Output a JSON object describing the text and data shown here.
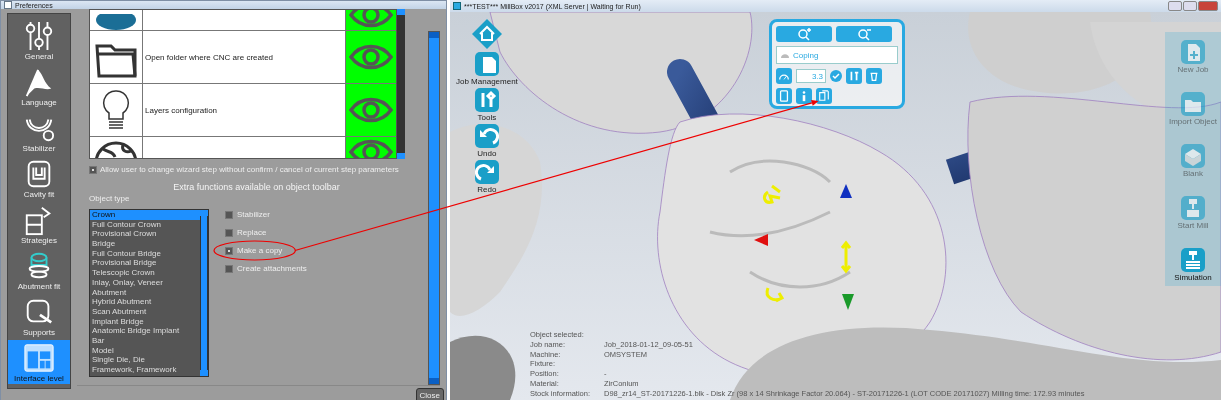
{
  "preferences": {
    "title": "Preferences",
    "sidebar": {
      "items": [
        {
          "label": "General",
          "selected": false
        },
        {
          "label": "Language",
          "selected": false
        },
        {
          "label": "Stabilizer",
          "selected": false
        },
        {
          "label": "Cavity fit",
          "selected": false
        },
        {
          "label": "Strategies",
          "selected": false
        },
        {
          "label": "Abutment fit",
          "selected": false
        },
        {
          "label": "Supports",
          "selected": false
        },
        {
          "label": "Interface level",
          "selected": true
        }
      ]
    },
    "tools_table": {
      "rows": [
        {
          "visible": true
        },
        {
          "label": "Open folder where CNC are created",
          "visible": true
        },
        {
          "label": "Layers configuration",
          "visible": true
        },
        {
          "visible": true
        }
      ]
    },
    "wizard_option": {
      "label": "Allow user to change wizard step without confirm / cancel of current step parameters",
      "checked": true
    },
    "section_title": "Extra functions available on object toolbar",
    "object_type": {
      "label": "Object type",
      "items": [
        {
          "label": "Crown",
          "selected": true
        },
        {
          "label": "Full Contour Crown",
          "selected": false
        },
        {
          "label": "Provisional Crown",
          "selected": false
        },
        {
          "label": "Bridge",
          "selected": false
        },
        {
          "label": "Full Contour Bridge",
          "selected": false
        },
        {
          "label": "Provisional Bridge",
          "selected": false
        },
        {
          "label": "Telescopic Crown",
          "selected": false
        },
        {
          "label": "Inlay, Onlay, Veneer",
          "selected": false
        },
        {
          "label": "Abutment",
          "selected": false
        },
        {
          "label": "Hybrid Abutment",
          "selected": false
        },
        {
          "label": "Scan Abutment",
          "selected": false
        },
        {
          "label": "Implant Bridge",
          "selected": false
        },
        {
          "label": "Anatomic Bridge Implant",
          "selected": false
        },
        {
          "label": "Bar",
          "selected": false
        },
        {
          "label": "Model",
          "selected": false
        },
        {
          "label": "Single Die, Die",
          "selected": false
        },
        {
          "label": "Framework, Framework",
          "selected": false
        }
      ]
    },
    "functions": [
      {
        "label": "Stabilizer",
        "checked": false,
        "highlighted": false
      },
      {
        "label": "Replace",
        "checked": false,
        "highlighted": false
      },
      {
        "label": "Make a copy",
        "checked": true,
        "highlighted": true
      },
      {
        "label": "Create attachments",
        "checked": false,
        "highlighted": false
      }
    ],
    "close_button": "Close"
  },
  "millbox": {
    "title": "***TEST*** MillBox v2017 (XML Server | Waiting for Run)",
    "left_toolbar": [
      {
        "label": "Job Management"
      },
      {
        "label": "Tools"
      },
      {
        "label": "Undo"
      },
      {
        "label": "Redo"
      }
    ],
    "right_toolbar": [
      {
        "label": "New Job",
        "active": false
      },
      {
        "label": "Import Object",
        "active": false
      },
      {
        "label": "Blank",
        "active": false
      },
      {
        "label": "Start Mill",
        "active": false
      },
      {
        "label": "Simulation",
        "active": true
      }
    ],
    "object_panel": {
      "material": "Coping",
      "value": "3.3"
    },
    "info": [
      {
        "label": "Object selected:"
      },
      {
        "label": "Job name:",
        "value": "Job_2018-01-12_09-05-51"
      },
      {
        "label": "Machine:",
        "value": "OMSYSTEM"
      },
      {
        "label": "Fixture:"
      },
      {
        "label": "Position:",
        "value": "-"
      },
      {
        "label": "Material:",
        "value": "ZirConium"
      },
      {
        "label": "Stock information:",
        "value": "D98_zr14_ST-20171226-1.blk - Disk Zr (98 x 14 Shrinkage Factor 20.064) - ST-20171226-1 (LOT CODE 20171027) Milling time: 172.93 minutes"
      }
    ]
  }
}
